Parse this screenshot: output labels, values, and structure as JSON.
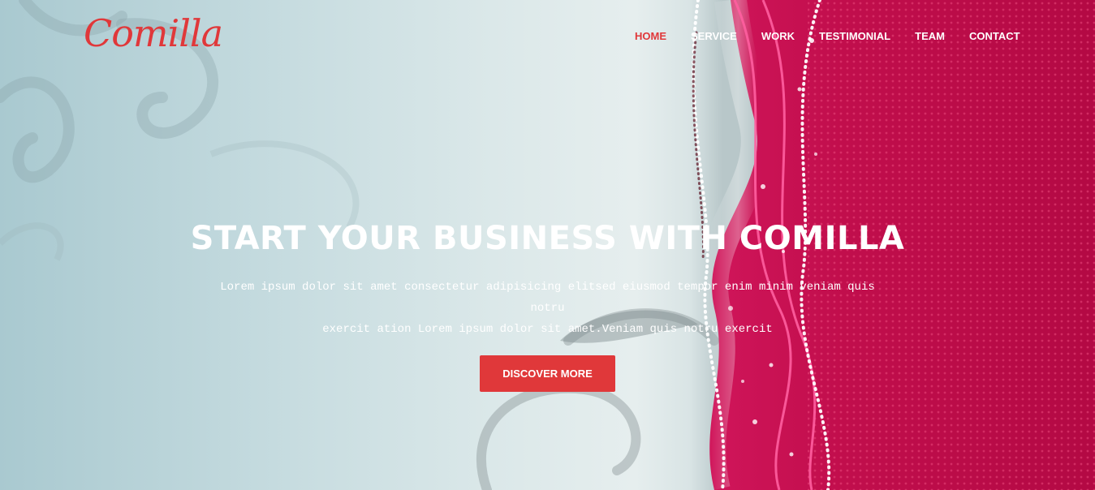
{
  "brand": {
    "logo_text": "Comilla"
  },
  "nav": {
    "items": [
      {
        "label": "HOME",
        "active": true
      },
      {
        "label": "SERVICE",
        "active": false
      },
      {
        "label": "WORK",
        "active": false
      },
      {
        "label": "TESTIMONIAL",
        "active": false
      },
      {
        "label": "TEAM",
        "active": false
      },
      {
        "label": "CONTACT",
        "active": false
      }
    ]
  },
  "hero": {
    "title": "START YOUR BUSINESS WITH COMILLA",
    "text_line1": "Lorem ipsum dolor sit amet consectetur adipisicing elitsed eiusmod tempor enim minim veniam quis notru",
    "text_line2": "exercit ation Lorem ipsum dolor sit amet.Veniam quis notru exercit",
    "cta_label": "DISCOVER MORE"
  },
  "colors": {
    "accent": "#e0383a",
    "hero_magenta": "#c8104a",
    "hero_light": "#e6eeee",
    "hero_blue": "#a9c9d0"
  },
  "background_image": "teal-to-magenta sparkle swirl wallpaper"
}
